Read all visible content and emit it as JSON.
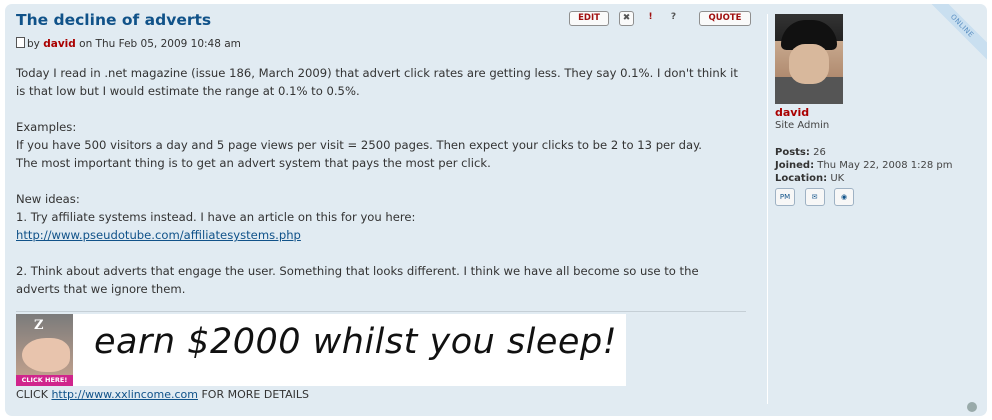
{
  "post": {
    "title": "The decline of adverts",
    "byline_prefix": "by",
    "author": "david",
    "date": "on Thu Feb 05, 2009 10:48 am",
    "online_badge": "ONLINE",
    "actions": {
      "edit": "EDIT",
      "delete": "✖",
      "report": "!",
      "info": "?",
      "quote": "QUOTE"
    },
    "paragraphs": [
      "Today I read in .net magazine (issue 186, March 2009) that advert click rates are getting less. They say 0.1%. I don't think it is that low but I would estimate the range at 0.1% to 0.5%.",
      "Examples:",
      "If you have 500 visitors a day and 5 page views per visit = 2500 pages. Then expect your clicks to be 2 to 13 per day.",
      "The most important thing is to get an advert system that pays the most per click.",
      "New ideas:",
      "1. Try affiliate systems instead. I have an article on this for you here:",
      "2. Think about adverts that engage the user. Something that looks different. I think we have all become so use to the adverts that we ignore them."
    ],
    "link1": "http://www.pseudotube.com/affiliatesystems.php",
    "banner": {
      "z": "Z",
      "click_here": "CLICK HERE!",
      "text": "earn $2000 whilst you sleep!"
    },
    "click_prefix": "CLICK",
    "click_link": "http://www.xxlincome.com",
    "click_suffix": "FOR MORE DETAILS"
  },
  "profile": {
    "name": "david",
    "rank": "Site Admin",
    "posts_label": "Posts:",
    "posts": "26",
    "joined_label": "Joined:",
    "joined": "Thu May 22, 2008 1:28 pm",
    "location_label": "Location:",
    "location": "UK",
    "pm_label": "PM"
  }
}
